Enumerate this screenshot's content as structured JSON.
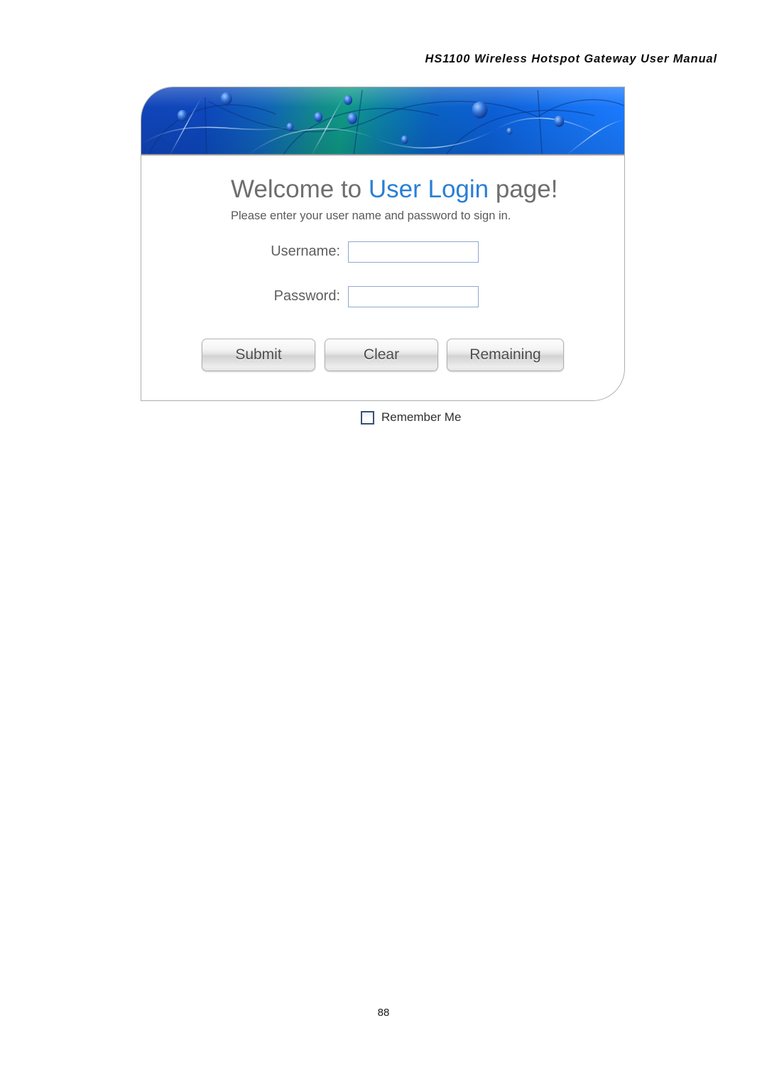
{
  "document": {
    "header_title": "HS1100 Wireless Hotspot Gateway User Manual",
    "page_number": "88"
  },
  "login_card": {
    "banner": {
      "icon": "network-nodes-graphic",
      "gradient_start": "#1144b8",
      "gradient_mid": "#0f9a85",
      "gradient_end": "#1b7bff"
    },
    "title": {
      "prefix": "Welcome to ",
      "highlight": "User Login",
      "suffix": " page!",
      "highlight_color": "#2a7fd4"
    },
    "subtitle": "Please enter your user name and password  to sign in.",
    "fields": [
      {
        "label": "Username:",
        "value": "",
        "placeholder": "",
        "type": "text"
      },
      {
        "label": "Password:",
        "value": "",
        "placeholder": "",
        "type": "password"
      }
    ],
    "buttons": [
      {
        "label": "Submit"
      },
      {
        "label": "Clear"
      },
      {
        "label": "Remaining"
      }
    ]
  },
  "remember_me": {
    "label": "Remember Me",
    "checked": false
  }
}
